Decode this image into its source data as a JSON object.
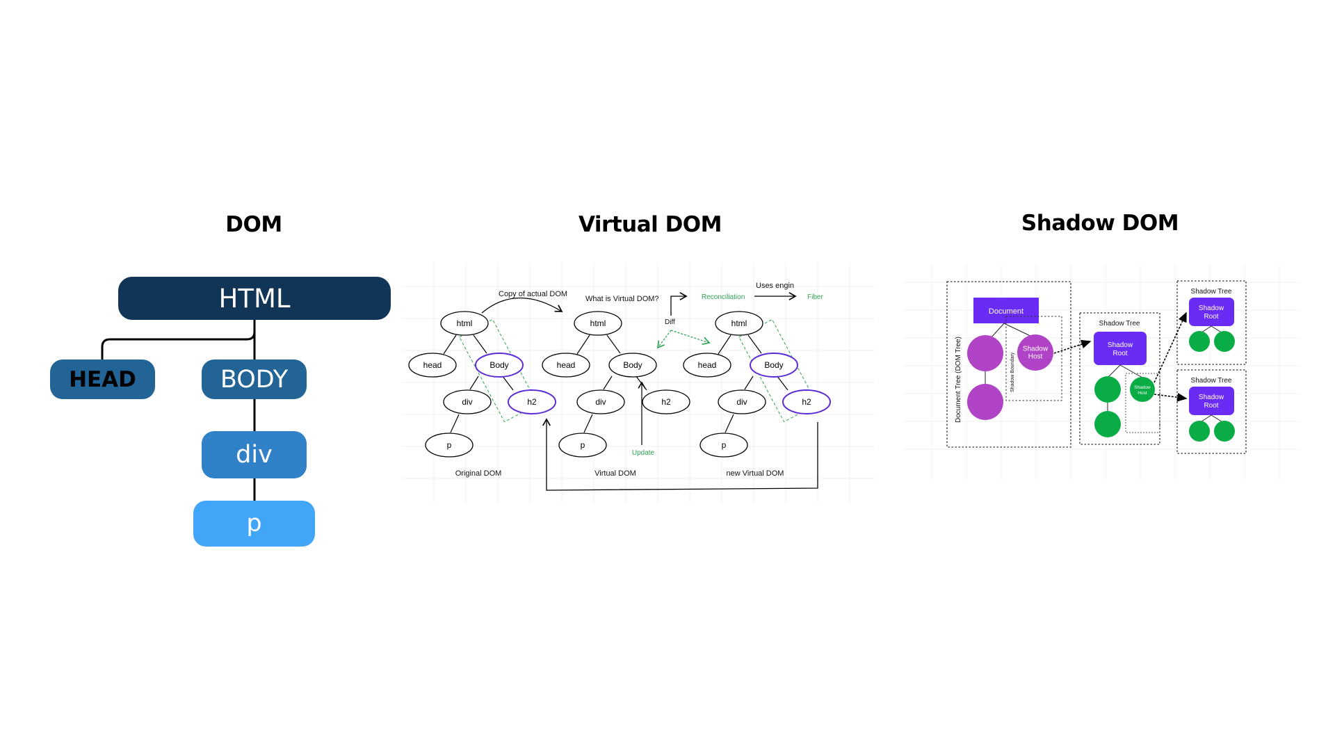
{
  "titles": {
    "dom": "DOM",
    "virtual_dom": "Virtual DOM",
    "shadow_dom": "Shadow DOM"
  },
  "colors": {
    "html_node": "#103556",
    "head_body_node": "#236497",
    "div_node": "#3181c8",
    "p_node": "#42a6f8",
    "connector": "#000000",
    "vdom_highlight": "#5b2bd6",
    "vdom_green": "#2ea352",
    "shadow_purple_box": "#6a2bf5",
    "shadow_host_circle": "#b043c6",
    "shadow_green_circle": "#0aad45",
    "grid": "#efefef"
  },
  "dom_tree": {
    "root": "HTML",
    "head": "HEAD",
    "body": "BODY",
    "div": "div",
    "p": "p"
  },
  "virtual_dom": {
    "labels": {
      "copy": "Copy of actual DOM",
      "question": "What is Virtual DOM?",
      "reconciliation": "Reconciliation",
      "uses_engine": "Uses engin",
      "fiber": "Fiber",
      "diff": "Diff",
      "update": "Update"
    },
    "trees": [
      {
        "caption": "Original DOM",
        "nodes": [
          "html",
          "head",
          "Body",
          "div",
          "h2",
          "p"
        ],
        "highlighted": [
          "Body",
          "h2"
        ]
      },
      {
        "caption": "Virtual DOM",
        "nodes": [
          "html",
          "head",
          "Body",
          "div",
          "h2",
          "p"
        ],
        "highlighted": []
      },
      {
        "caption": "new Virtual DOM",
        "nodes": [
          "html",
          "head",
          "Body",
          "div",
          "h2",
          "p"
        ],
        "highlighted": [
          "Body",
          "h2"
        ]
      }
    ]
  },
  "shadow_dom": {
    "document_tree_label": "Document Tree (DOM Tree)",
    "document": "Document",
    "shadow_boundary": "Shadow Boundary",
    "shadow_host": "Shadow Host",
    "shadow_tree_title": "Shadow Tree",
    "shadow_root": "Shadow Root",
    "nested_shadow_host": "Shadow Host"
  }
}
